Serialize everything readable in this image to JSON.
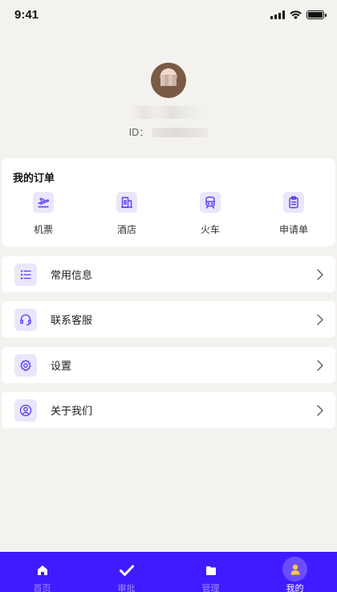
{
  "status_bar": {
    "time": "9:41"
  },
  "profile": {
    "name": "•••••",
    "id_label": "ID：",
    "id_value": "••••••"
  },
  "orders": {
    "title": "我的订单",
    "items": [
      {
        "label": "机票",
        "icon": "plane-icon"
      },
      {
        "label": "酒店",
        "icon": "hotel-icon"
      },
      {
        "label": "火车",
        "icon": "train-icon"
      },
      {
        "label": "申请单",
        "icon": "clipboard-icon"
      }
    ]
  },
  "menu": [
    {
      "label": "常用信息",
      "icon": "list-icon"
    },
    {
      "label": "联系客服",
      "icon": "headset-icon"
    },
    {
      "label": "设置",
      "icon": "gear-icon"
    },
    {
      "label": "关于我们",
      "icon": "user-circle-icon"
    }
  ],
  "tabs": [
    {
      "label": "首页",
      "icon": "home-icon"
    },
    {
      "label": "审批",
      "icon": "check-icon"
    },
    {
      "label": "管理",
      "icon": "folder-icon"
    },
    {
      "label": "我的",
      "icon": "person-icon",
      "active": true
    }
  ],
  "colors": {
    "accent": "#3f1cff",
    "icon_bg": "#ebe6fb",
    "icon_stroke": "#5a3df0",
    "page_bg": "#f4f2ef"
  }
}
